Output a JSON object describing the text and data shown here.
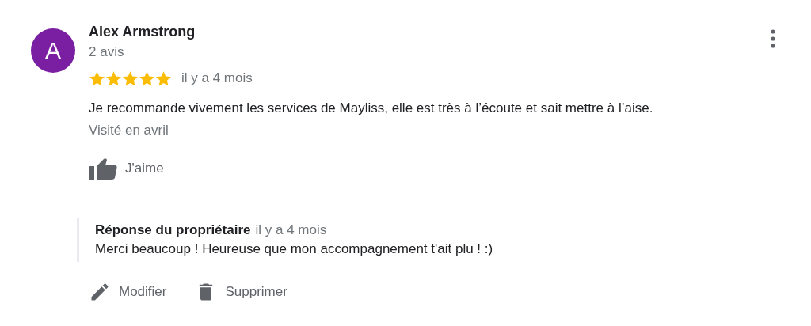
{
  "review": {
    "avatar_letter": "A",
    "author": "Alex Armstrong",
    "review_count": "2 avis",
    "stars": 5,
    "time": "il y a 4 mois",
    "text": "Je recommande vivement les services de Mayliss, elle est très à l’écoute et sait mettre à l’aise.",
    "visited": "Visité en avril",
    "like_label": "J'aime"
  },
  "owner_reply": {
    "title": "Réponse du propriétaire",
    "time": "il y a 4 mois",
    "text": "Merci beaucoup ! Heureuse que mon accompagnement t'ait plu ! :)"
  },
  "actions": [
    {
      "kind": "edit",
      "label": "Modifier"
    },
    {
      "kind": "delete",
      "label": "Supprimer"
    }
  ]
}
